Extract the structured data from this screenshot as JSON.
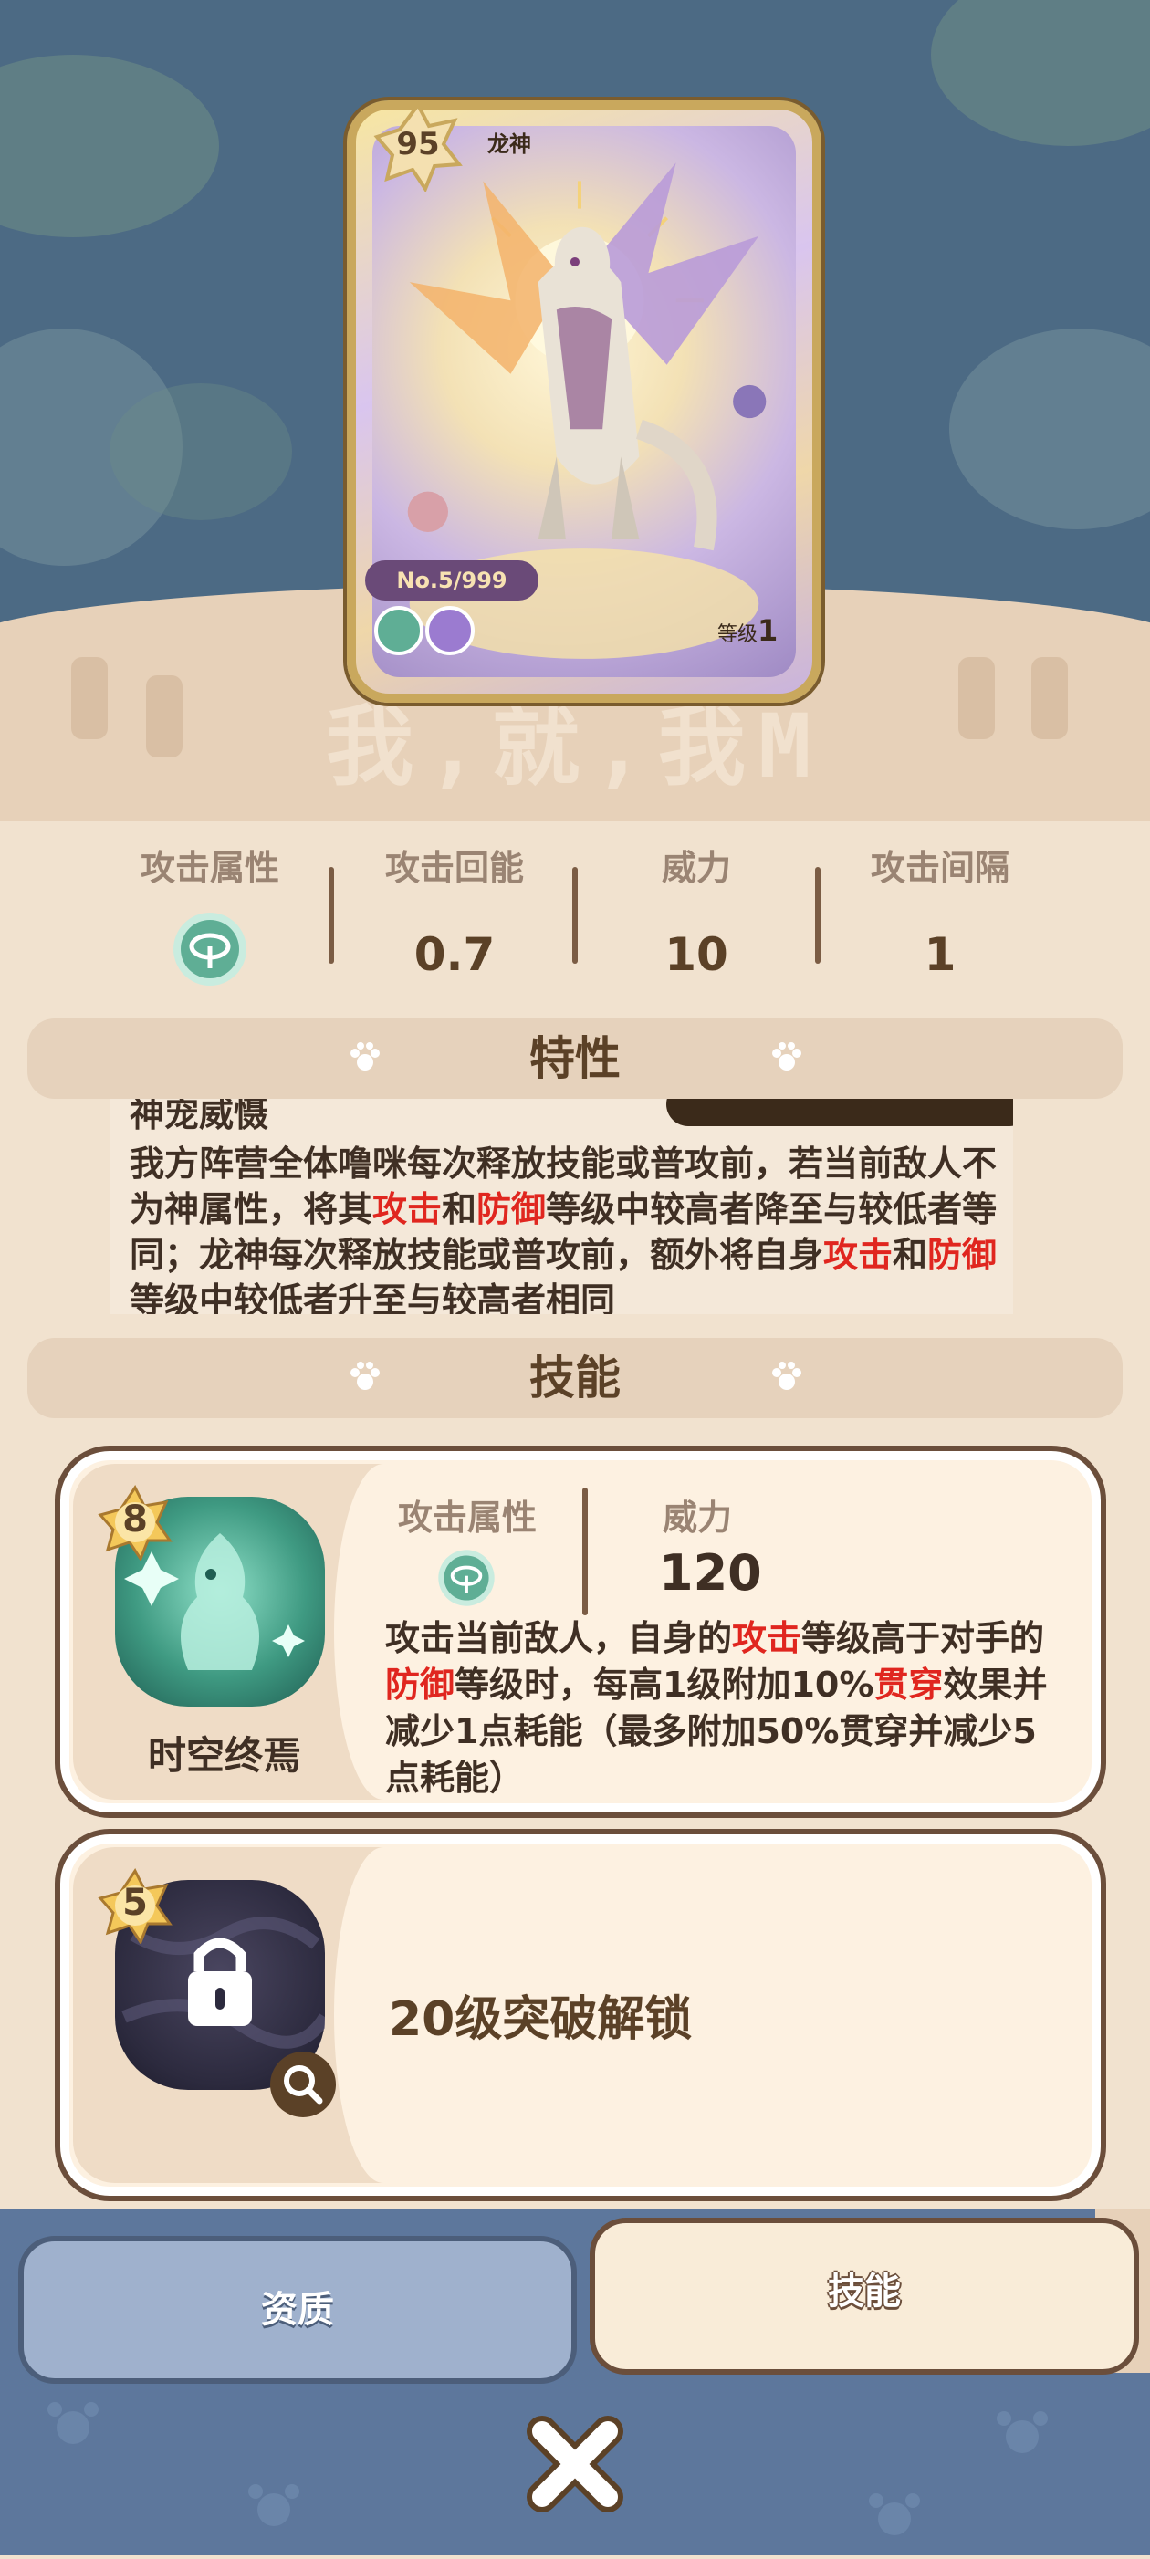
{
  "card": {
    "level": "95",
    "name": "龙神",
    "number": "No.5/999",
    "grade_label": "等级",
    "grade_value": "1"
  },
  "watermark": "我,就,我M",
  "stats": [
    {
      "label": "攻击属性",
      "value": ""
    },
    {
      "label": "攻击回能",
      "value": "0.7"
    },
    {
      "label": "威力",
      "value": "10"
    },
    {
      "label": "攻击间隔",
      "value": "1"
    }
  ],
  "trait": {
    "section_title": "特性",
    "cut_line": "神宠威慑",
    "text_parts": [
      {
        "t": "我方阵营全体噜咪每次释放技能或普攻前，若当前敌人不为神属性，将其",
        "red": false
      },
      {
        "t": "攻击",
        "red": true
      },
      {
        "t": "和",
        "red": false
      },
      {
        "t": "防御",
        "red": true
      },
      {
        "t": "等级中较高者降至与较低者等同；龙神每次释放技能或普攻前，额外将自身",
        "red": false
      },
      {
        "t": "攻击",
        "red": true
      },
      {
        "t": "和",
        "red": false
      },
      {
        "t": "防御",
        "red": true
      },
      {
        "t": "等级中较低者升至与较高者相同",
        "red": false
      }
    ]
  },
  "skills": {
    "section_title": "技能",
    "skill1": {
      "cost": "8",
      "name": "时空终焉",
      "attr_label": "攻击属性",
      "power_label": "威力",
      "power_value": "120",
      "desc_parts": [
        {
          "t": "攻击当前敌人，自身的",
          "red": false
        },
        {
          "t": "攻击",
          "red": true
        },
        {
          "t": "等级高于对手的",
          "red": false
        },
        {
          "t": "防御",
          "red": true
        },
        {
          "t": "等级时，每高1级附加10%",
          "red": false
        },
        {
          "t": "贯穿",
          "red": true
        },
        {
          "t": "效果并减少1点耗能（最多附加50%贯穿并减少5点耗能）",
          "red": false
        }
      ]
    },
    "skill2": {
      "cost": "5",
      "locked_text": "20级突破解锁"
    }
  },
  "tabs": {
    "left": "资质",
    "right": "技能"
  },
  "colors": {
    "element_green": "#5fae95",
    "accent_red": "#e0261f",
    "brown": "#5b4127"
  },
  "icons": {
    "element": "wind-element-icon",
    "close": "close-icon",
    "lock": "lock-icon",
    "magnifier": "magnifier-icon"
  }
}
